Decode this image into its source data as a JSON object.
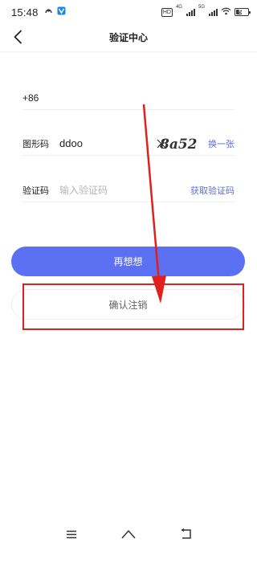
{
  "status_bar": {
    "time": "15:48",
    "hd_label": "HD",
    "network_label_1": "4G",
    "network_label_2": "5G",
    "battery_level": "51",
    "battery_fraction": 0.51
  },
  "header": {
    "title": "验证中心",
    "back_icon": "chevron-left-icon"
  },
  "form": {
    "phone_prefix": "+86",
    "captcha_label": "图形码",
    "captcha_value": "ddoo",
    "captcha_text": "8a52",
    "refresh_captcha_label": "换一张",
    "code_label": "验证码",
    "code_placeholder": "输入验证码",
    "get_code_label": "获取验证码"
  },
  "actions": {
    "think_again_label": "再想想",
    "confirm_cancel_label": "确认注销"
  },
  "colors": {
    "primary": "#5b70f2",
    "link": "#5b6ee1",
    "annotation": "#e0201c"
  },
  "nav_bar": {
    "icons": [
      "menu-icon",
      "home-icon",
      "back-icon"
    ]
  }
}
